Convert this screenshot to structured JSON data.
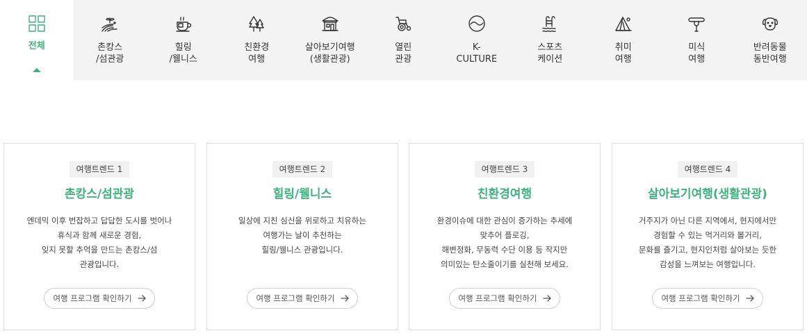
{
  "categories": [
    {
      "label": "전체",
      "icon": "grid-icon",
      "active": true
    },
    {
      "label": "촌캉스\n/섬관광",
      "icon": "field-icon"
    },
    {
      "label": "힐링\n/웰니스",
      "icon": "tea-cup-icon"
    },
    {
      "label": "친환경\n여행",
      "icon": "trees-icon"
    },
    {
      "label": "살아보기여행\n(생활관광)",
      "icon": "house-icon"
    },
    {
      "label": "열린\n관광",
      "icon": "wheelchair-icon"
    },
    {
      "label": "K-\nCULTURE",
      "icon": "k-circle-icon"
    },
    {
      "label": "스포츠\n케이션",
      "icon": "pool-ladder-icon"
    },
    {
      "label": "취미\n여행",
      "icon": "tent-icon"
    },
    {
      "label": "미식\n여행",
      "icon": "fork-sausage-icon"
    },
    {
      "label": "반려동물\n동반여행",
      "icon": "dog-icon"
    }
  ],
  "cards": [
    {
      "badge": "여행트렌드 1",
      "title": "촌캉스/섬관광",
      "desc": "엔데믹 이후 번잡하고 답답한 도시를 벗어나\n휴식과 함께 새로운 경험,\n잊지 못할 추억을 만드는 촌캉스/섬\n관광입니다.",
      "button": "여행 프로그램 확인하기"
    },
    {
      "badge": "여행트렌드 2",
      "title": "힐링/웰니스",
      "desc": "일상에 지친 심신을 위로하고 치유하는\n여행가는 날이 추천하는\n힐링/웰니스 관광입니다.",
      "button": "여행 프로그램 확인하기"
    },
    {
      "badge": "여행트렌드 3",
      "title": "친환경여행",
      "desc": "환경이슈에 대한 관심이 증가하는 추세에\n맞추어 플로깅,\n해변정화, 무동력 수단 이용 등 작지만\n의미있는 탄소줄이기를 실천해 보세요.",
      "button": "여행 프로그램 확인하기"
    },
    {
      "badge": "여행트렌드 4",
      "title": "살아보기여행(생활관광)",
      "desc": "거주지가 아닌 다른 지역에서, 현지에서만\n경험할 수 있는 먹거리와 볼거리,\n문화를 즐기고, 현지인처럼 살아보는 듯한\n감성을 느껴보는 여행입니다.",
      "button": "여행 프로그램 확인하기"
    }
  ],
  "colors": {
    "accent": "#3cb37d",
    "bar_bg": "#f3f3f3",
    "border": "#dddddd"
  }
}
